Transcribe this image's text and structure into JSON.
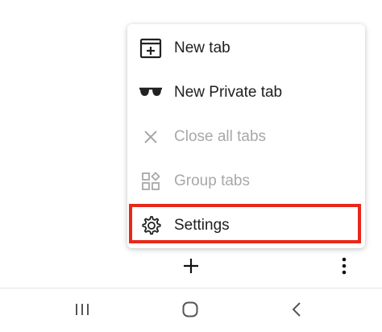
{
  "menu": {
    "items": [
      {
        "label": "New tab",
        "icon": "new-tab-icon",
        "enabled": true
      },
      {
        "label": "New Private tab",
        "icon": "private-glasses-icon",
        "enabled": true
      },
      {
        "label": "Close all tabs",
        "icon": "close-icon",
        "enabled": false
      },
      {
        "label": "Group tabs",
        "icon": "group-tabs-icon",
        "enabled": false
      },
      {
        "label": "Settings",
        "icon": "gear-icon",
        "enabled": true,
        "highlighted": true
      }
    ]
  },
  "toolbar": {
    "add_icon": "plus-icon",
    "more_icon": "more-vertical-icon"
  },
  "navbar": {
    "recent_icon": "recent-apps-icon",
    "home_icon": "home-icon",
    "back_icon": "back-icon"
  },
  "colors": {
    "highlight": "#e8271b",
    "text": "#202020",
    "disabled_text": "#a8a8a8",
    "nav_icon": "#555555"
  }
}
